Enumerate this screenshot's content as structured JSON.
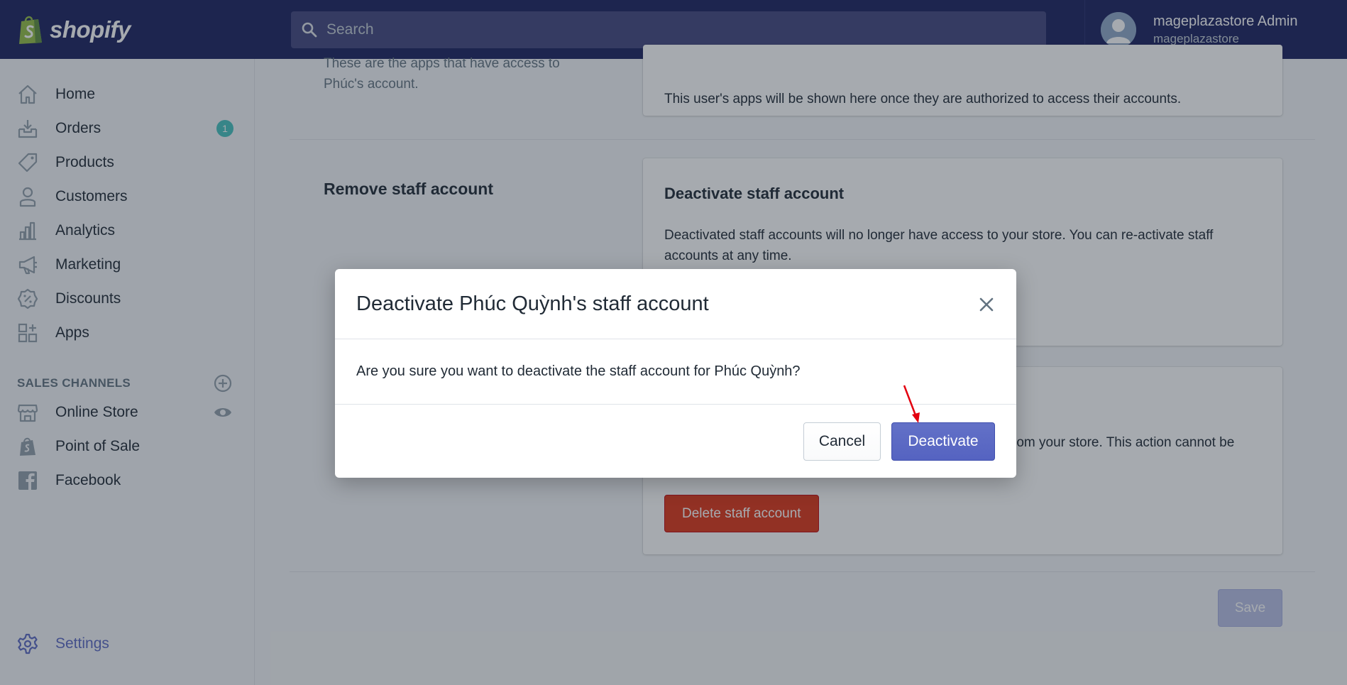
{
  "brand": {
    "name": "shopify"
  },
  "search": {
    "placeholder": "Search"
  },
  "user": {
    "name": "mageplazastore Admin",
    "store": "mageplazastore"
  },
  "sidebar": {
    "items": [
      {
        "label": "Home",
        "icon": "home-icon"
      },
      {
        "label": "Orders",
        "icon": "orders-icon",
        "badge": "1"
      },
      {
        "label": "Products",
        "icon": "tag-icon"
      },
      {
        "label": "Customers",
        "icon": "person-icon"
      },
      {
        "label": "Analytics",
        "icon": "bar-chart-icon"
      },
      {
        "label": "Marketing",
        "icon": "megaphone-icon"
      },
      {
        "label": "Discounts",
        "icon": "discount-icon"
      },
      {
        "label": "Apps",
        "icon": "apps-icon"
      }
    ],
    "sales_channels_label": "SALES CHANNELS",
    "channels": [
      {
        "label": "Online Store",
        "icon": "store-icon"
      },
      {
        "label": "Point of Sale",
        "icon": "pos-icon"
      },
      {
        "label": "Facebook",
        "icon": "facebook-icon"
      }
    ],
    "settings_label": "Settings"
  },
  "main": {
    "apps_desc": "These are the apps that have access to Phúc's account.",
    "apps_note": "This user's apps will be shown here once they are authorized to access their accounts.",
    "remove_title": "Remove staff account",
    "deactivate_card": {
      "title": "Deactivate staff account",
      "body": "Deactivated staff accounts will no longer have access to your store. You can re-activate staff accounts at any time."
    },
    "delete_card": {
      "body_fragment": "rom your store. This action cannot be",
      "button": "Delete staff account"
    },
    "save_label": "Save"
  },
  "modal": {
    "title": "Deactivate Phúc Quỳnh's staff account",
    "body": "Are you sure you want to deactivate the staff account for Phúc Quỳnh?",
    "cancel_label": "Cancel",
    "confirm_label": "Deactivate"
  },
  "colors": {
    "topbar": "#1c2260",
    "primary": "#5c6ac4",
    "danger": "#de3618",
    "badge": "#47c1bf",
    "annotation_arrow": "#e3000f"
  }
}
